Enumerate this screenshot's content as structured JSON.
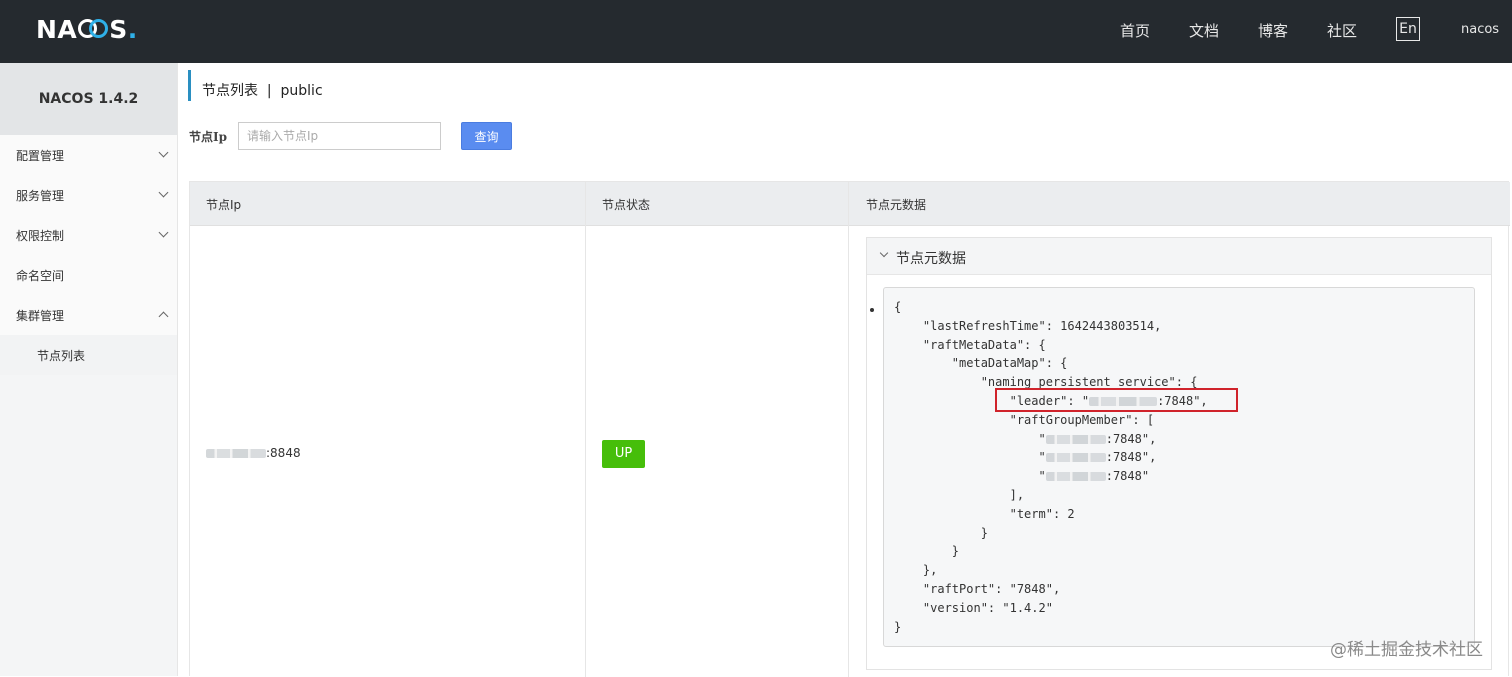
{
  "brand": {
    "logo": "NACOS."
  },
  "nav": {
    "items": [
      "首页",
      "文档",
      "博客",
      "社区"
    ],
    "lang": "En",
    "user": "nacos"
  },
  "sidebar": {
    "title": "NACOS 1.4.2",
    "items": [
      {
        "label": "配置管理",
        "expanded": false
      },
      {
        "label": "服务管理",
        "expanded": false
      },
      {
        "label": "权限控制",
        "expanded": false
      },
      {
        "label": "命名空间"
      },
      {
        "label": "集群管理",
        "expanded": true
      }
    ],
    "sub_items": [
      "节点列表"
    ]
  },
  "page": {
    "title": "节点列表  |  public"
  },
  "filter": {
    "label": "节点Ip",
    "placeholder": "请输入节点Ip",
    "button": "查询"
  },
  "table": {
    "headers": [
      "节点Ip",
      "节点状态",
      "节点元数据"
    ],
    "row": {
      "ip_suffix": ":8848",
      "status": "UP",
      "metadata_title": "节点元数据",
      "metadata_lines": [
        "{",
        "    \"lastRefreshTime\": 1642443803514,",
        "    \"raftMetaData\": {",
        "        \"metaDataMap\": {",
        "            \"naming_persistent_service\": {",
        "                \"leader\": \"",
        "                \"raftGroupMember\": [",
        "                    \"",
        "                    \"",
        "                    \"",
        "                ],",
        "                \"term\": 2",
        "            }",
        "        }",
        "    },",
        "    \"raftPort\": \"7848\",",
        "    \"version\": \"1.4.2\"",
        "}"
      ],
      "leader_suffix": ":7848\",",
      "member_suffixes": [
        ":7848\",",
        ":7848\",",
        ":7848\""
      ]
    }
  },
  "watermark": "@稀土掘金技术社区"
}
